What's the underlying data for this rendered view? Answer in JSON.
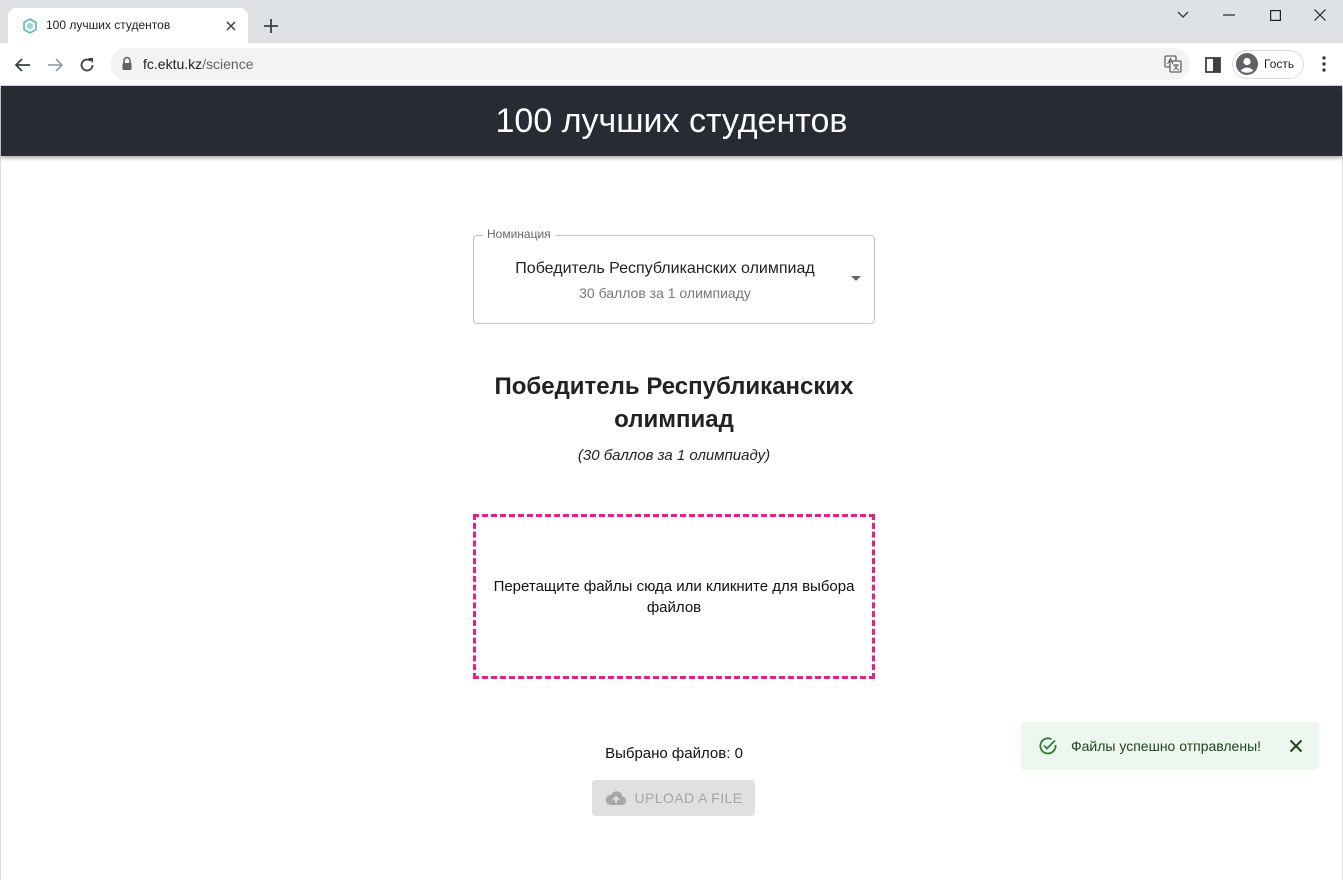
{
  "browser": {
    "tab_title": "100 лучших студентов",
    "url_host": "fc.ektu.kz",
    "url_path": "/science",
    "profile_label": "Гость"
  },
  "appbar": {
    "title": "100 лучших студентов"
  },
  "nomination": {
    "legend": "Номинация",
    "selected_primary": "Победитель Республиканских олимпиад",
    "selected_secondary": "30 баллов за 1 олимпиаду"
  },
  "section": {
    "title": "Победитель Республиканских олимпиад",
    "subtitle": "(30 баллов за 1 олимпиаду)"
  },
  "dropzone": {
    "text": "Перетащите файлы сюда или кликните для выбора файлов"
  },
  "files": {
    "count_text": "Выбрано файлов: 0"
  },
  "upload_button": {
    "label": "UPLOAD A FILE"
  },
  "snackbar": {
    "message": "Файлы успешно отправлены!"
  },
  "colors": {
    "appbar_bg": "#272b33",
    "dropzone_border": "#e3218c",
    "snackbar_bg": "#edf7ed",
    "snackbar_icon": "#2e7d32"
  }
}
